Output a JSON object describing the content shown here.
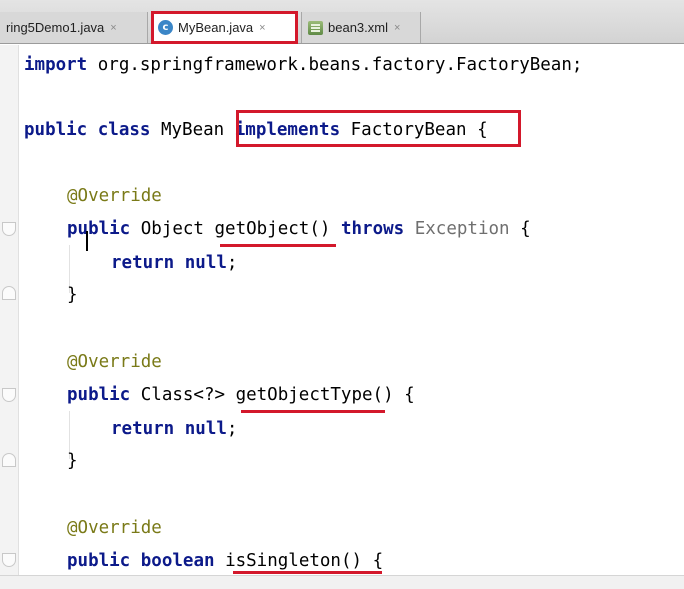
{
  "tabs": [
    {
      "label": "ring5Demo1.java",
      "close": "×",
      "icon": "java-class-icon"
    },
    {
      "label": "MyBean.java",
      "close": "×",
      "icon": "java-class-icon",
      "active": true
    },
    {
      "label": "bean3.xml",
      "close": "×",
      "icon": "xml-file-icon"
    }
  ],
  "code": {
    "l1_kw": "import",
    "l1_rest": " org.springframework.beans.factory.FactoryBean;",
    "l2_kw1": "public",
    "l2_sp1": " ",
    "l2_kw2": "class",
    "l2_name": " MyBean ",
    "l2_kw3": "implements",
    "l2_rest": " FactoryBean {",
    "ann1": "@Override",
    "m1_kw": "public",
    "m1_type": " Object ",
    "m1_name": "getObject()",
    "m1_sp": " ",
    "m1_throws": "throws",
    "m1_exc": " Exception",
    "m1_brace": " {",
    "ret_kw": "return",
    "ret_sp": " ",
    "ret_null": "null",
    "ret_semi": ";",
    "close_brace": "}",
    "ann2": "@Override",
    "m2_kw": "public",
    "m2_type": " Class<?> ",
    "m2_name": "getObjectType",
    "m2_rest": "() {",
    "ann3": "@Override",
    "m3_kw1": "public",
    "m3_sp": " ",
    "m3_kw2": "boolean",
    "m3_sp2": " ",
    "m3_name": "isSingleton()",
    "m3_rest": " {"
  },
  "colors": {
    "keyword": "#0c1a8a",
    "annotation": "#7a7a18",
    "highlight": "#d3182b"
  }
}
